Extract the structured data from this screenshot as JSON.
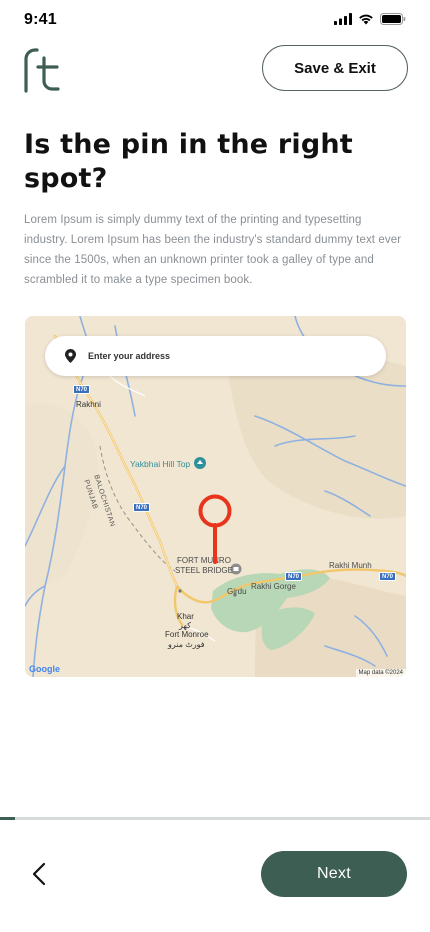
{
  "status_bar": {
    "time": "9:41",
    "icons": [
      "cellular-signal-icon",
      "wifi-icon",
      "battery-icon"
    ]
  },
  "header": {
    "logo_icon": "ft-logo-icon",
    "save_exit_label": "Save & Exit"
  },
  "page": {
    "title": "Is the pin in the right spot?",
    "description": "Lorem Ipsum is simply dummy text of the printing and typesetting industry. Lorem Ipsum has been the industry's standard dummy text ever since the 1500s, when an unknown printer took a galley of type and scrambled it to make a type specimen book."
  },
  "map": {
    "search": {
      "icon": "location-pin-icon",
      "placeholder": "Enter your address",
      "value": ""
    },
    "labels": {
      "rakhni": "Rakhni",
      "yakbhai": "Yakbhai Hill Top",
      "balochistan": "BALOCHISTAN",
      "punjab": "PUNJAB",
      "fort_munro_bridge_1": "FORT MUNRO",
      "fort_munro_bridge_2": "STEEL BRIDGE",
      "rakhi_gorge": "Rakhi Gorge",
      "rakhi_munh": "Rakhi Munh",
      "girdu": "Girdu",
      "khar": "Khar",
      "khar_urdu": "کھر",
      "fort_monroe": "Fort Monroe",
      "fort_monroe_urdu": "فورٹ منرو"
    },
    "road_badges": {
      "n70_a": "N70",
      "n70_b": "N70",
      "n70_c": "N70",
      "n70_d": "N70"
    },
    "google_logo": "Google",
    "attribution": "Map data ©2024",
    "pin_color": "#e8341c"
  },
  "footer": {
    "progress": 0.035,
    "back_icon": "chevron-left-icon",
    "next_label": "Next"
  },
  "colors": {
    "primary": "#3d5e53",
    "pin": "#e8341c",
    "text_muted": "#8a8f94"
  }
}
